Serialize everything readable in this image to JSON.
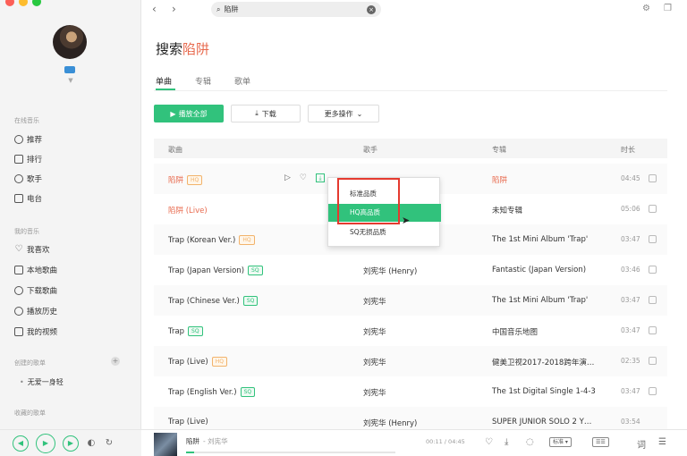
{
  "window": {
    "traffic_colors": [
      "#fc5f57",
      "#fdbc2e",
      "#28c840"
    ]
  },
  "sidebar": {
    "sections": [
      {
        "title": "在线音乐",
        "items": [
          {
            "label": "推荐",
            "icon": "disc-icon"
          },
          {
            "label": "排行",
            "icon": "chart-icon"
          },
          {
            "label": "歌手",
            "icon": "person-icon"
          },
          {
            "label": "电台",
            "icon": "radio-icon"
          }
        ]
      },
      {
        "title": "我的音乐",
        "items": [
          {
            "label": "我喜欢",
            "icon": "heart-icon"
          },
          {
            "label": "本地歌曲",
            "icon": "monitor-icon"
          },
          {
            "label": "下载歌曲",
            "icon": "download-icon"
          },
          {
            "label": "播放历史",
            "icon": "clock-icon"
          },
          {
            "label": "我的视频",
            "icon": "video-icon"
          }
        ]
      }
    ],
    "created_title": "创建的歌单",
    "playlist": "无爱一身轻",
    "favorited_title": "收藏的歌单"
  },
  "topbar": {
    "search_value": "陷阱"
  },
  "page": {
    "title_prefix": "搜索",
    "title_keyword": "陷阱",
    "tabs": [
      "单曲",
      "专辑",
      "歌单"
    ],
    "actions": {
      "play_all": "播放全部",
      "download": "下载",
      "more": "更多操作"
    }
  },
  "table": {
    "headers": {
      "title": "歌曲",
      "artist": "歌手",
      "album": "专辑",
      "duration": "时长"
    },
    "rows": [
      {
        "title": "陷阱",
        "badge": "HQ",
        "artist": "",
        "album": "陷阱",
        "duration": "04:45"
      },
      {
        "title": "陷阱 (Live)",
        "badge": "",
        "artist": "",
        "album": "未知专辑",
        "duration": "05:06"
      },
      {
        "title": "Trap (Korean Ver.)",
        "badge": "HQ",
        "artist": "",
        "album": "The 1st Mini Album 'Trap'",
        "duration": "03:47"
      },
      {
        "title": "Trap (Japan Version)",
        "badge": "SQ",
        "artist": "刘宪华 (Henry)",
        "album": "Fantastic (Japan Version)",
        "duration": "03:46"
      },
      {
        "title": "Trap (Chinese Ver.)",
        "badge": "SQ",
        "artist": "刘宪华",
        "album": "The 1st Mini Album 'Trap'",
        "duration": "03:47"
      },
      {
        "title": "Trap",
        "badge": "SQ",
        "artist": "刘宪华",
        "album": "中国音乐地图",
        "duration": "03:47"
      },
      {
        "title": "Trap (Live)",
        "badge": "HQ",
        "artist": "刘宪华",
        "album": "健美卫视2017-2018跨年演…",
        "duration": "02:35"
      },
      {
        "title": "Trap (English Ver.)",
        "badge": "SQ",
        "artist": "刘宪华",
        "album": "The 1st Digital Single 1-4-3",
        "duration": "03:47"
      },
      {
        "title": "Trap (Live)",
        "badge": "",
        "artist": "刘宪华 (Henry)",
        "album": "SUPER JUNIOR SOLO 2 Y…",
        "duration": "03:54"
      }
    ]
  },
  "dropdown": {
    "items": [
      "标准品质",
      "HQ高品质",
      "SQ无损品质"
    ],
    "active_index": 1
  },
  "player": {
    "title": "陷阱",
    "artist": "- 刘宪华",
    "time": "00:11 / 04:45",
    "progress": 0.04,
    "mode_label": "标准",
    "lyric_label": "词"
  }
}
